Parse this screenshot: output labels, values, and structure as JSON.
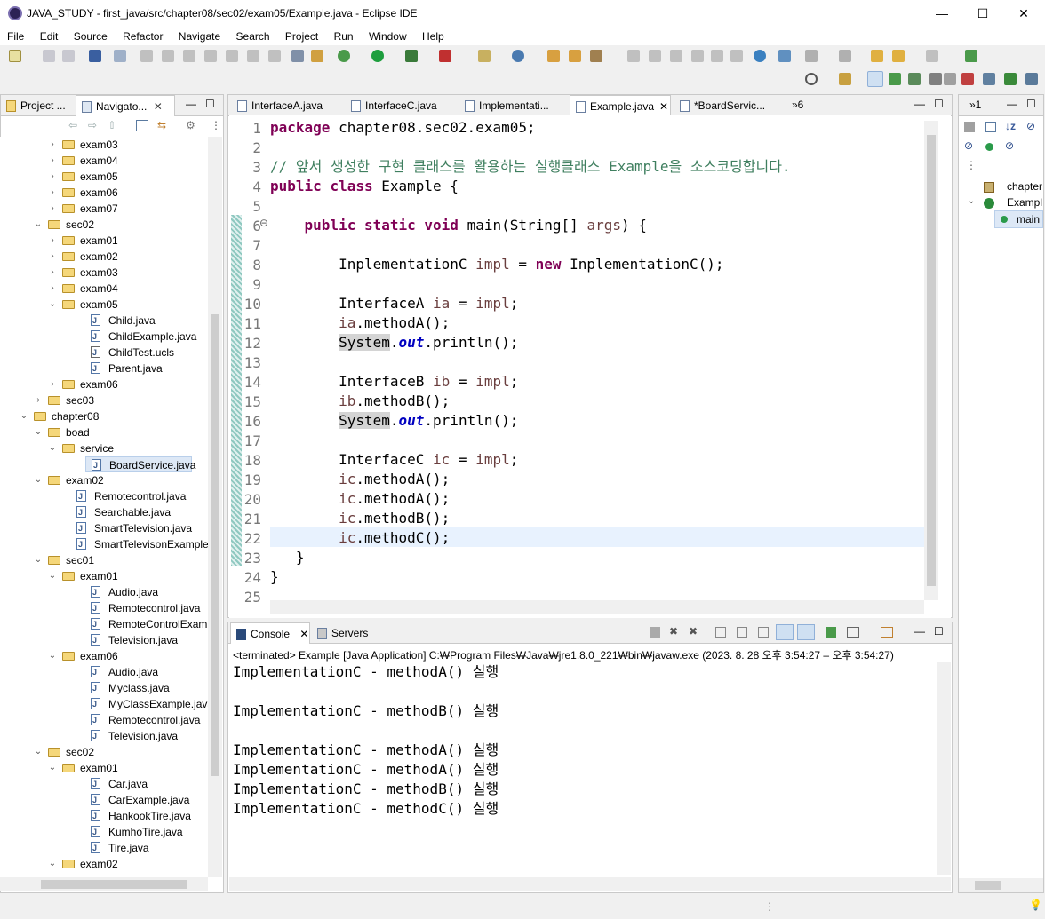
{
  "window": {
    "title": "JAVA_STUDY - first_java/src/chapter08/sec02/exam05/Example.java - Eclipse IDE",
    "minimize": "—",
    "maximize": "☐",
    "close": "✕"
  },
  "menu": [
    "File",
    "Edit",
    "Source",
    "Refactor",
    "Navigate",
    "Search",
    "Project",
    "Run",
    "Window",
    "Help"
  ],
  "left_tabs": {
    "project": "Project ...",
    "navigator": "Navigato..."
  },
  "editor_tabs": [
    "InterfaceA.java",
    "InterfaceC.java",
    "Implementati...",
    "Example.java",
    "*BoardServic..."
  ],
  "editor_overflow": "»6",
  "tree": [
    {
      "label": "exam03",
      "indent": 1,
      "type": "folder",
      "arrow": "›"
    },
    {
      "label": "exam04",
      "indent": 1,
      "type": "folder",
      "arrow": "›"
    },
    {
      "label": "exam05",
      "indent": 1,
      "type": "folder",
      "arrow": "›"
    },
    {
      "label": "exam06",
      "indent": 1,
      "type": "folder",
      "arrow": "›"
    },
    {
      "label": "exam07",
      "indent": 1,
      "type": "folder",
      "arrow": "›"
    },
    {
      "label": "sec02",
      "indent": 0,
      "type": "folder",
      "arrow": "⌄"
    },
    {
      "label": "exam01",
      "indent": 1,
      "type": "folder",
      "arrow": "›"
    },
    {
      "label": "exam02",
      "indent": 1,
      "type": "folder",
      "arrow": "›"
    },
    {
      "label": "exam03",
      "indent": 1,
      "type": "folder",
      "arrow": "›"
    },
    {
      "label": "exam04",
      "indent": 1,
      "type": "folder",
      "arrow": "›"
    },
    {
      "label": "exam05",
      "indent": 1,
      "type": "folder",
      "arrow": "⌄"
    },
    {
      "label": "Child.java",
      "indent": 2,
      "type": "file"
    },
    {
      "label": "ChildExample.java",
      "indent": 2,
      "type": "file"
    },
    {
      "label": "ChildTest.ucls",
      "indent": 2,
      "type": "ucls"
    },
    {
      "label": "Parent.java",
      "indent": 2,
      "type": "file"
    },
    {
      "label": "exam06",
      "indent": 1,
      "type": "folder",
      "arrow": "›"
    },
    {
      "label": "sec03",
      "indent": 0,
      "type": "folder",
      "arrow": "›"
    },
    {
      "label": "chapter08",
      "indent": -1,
      "type": "folder",
      "arrow": "⌄"
    },
    {
      "label": "boad",
      "indent": 0,
      "type": "folder",
      "arrow": "⌄"
    },
    {
      "label": "service",
      "indent": 1,
      "type": "folder",
      "arrow": "⌄"
    },
    {
      "label": "BoardService.java",
      "indent": 2,
      "type": "file",
      "selected": true
    },
    {
      "label": "exam02",
      "indent": 0,
      "type": "folder",
      "arrow": "⌄"
    },
    {
      "label": "Remotecontrol.java",
      "indent": 1,
      "type": "file"
    },
    {
      "label": "Searchable.java",
      "indent": 1,
      "type": "file"
    },
    {
      "label": "SmartTelevision.java",
      "indent": 1,
      "type": "file"
    },
    {
      "label": "SmartTelevisonExample.java",
      "indent": 1,
      "type": "file"
    },
    {
      "label": "sec01",
      "indent": 0,
      "type": "folder",
      "arrow": "⌄"
    },
    {
      "label": "exam01",
      "indent": 1,
      "type": "folder",
      "arrow": "⌄"
    },
    {
      "label": "Audio.java",
      "indent": 2,
      "type": "file"
    },
    {
      "label": "Remotecontrol.java",
      "indent": 2,
      "type": "file"
    },
    {
      "label": "RemoteControlExample.jav",
      "indent": 2,
      "type": "file"
    },
    {
      "label": "Television.java",
      "indent": 2,
      "type": "file"
    },
    {
      "label": "exam06",
      "indent": 1,
      "type": "folder",
      "arrow": "⌄"
    },
    {
      "label": "Audio.java",
      "indent": 2,
      "type": "file"
    },
    {
      "label": "Myclass.java",
      "indent": 2,
      "type": "file"
    },
    {
      "label": "MyClassExample.java",
      "indent": 2,
      "type": "file"
    },
    {
      "label": "Remotecontrol.java",
      "indent": 2,
      "type": "file"
    },
    {
      "label": "Television.java",
      "indent": 2,
      "type": "file"
    },
    {
      "label": "sec02",
      "indent": 0,
      "type": "folder",
      "arrow": "⌄"
    },
    {
      "label": "exam01",
      "indent": 1,
      "type": "folder",
      "arrow": "⌄"
    },
    {
      "label": "Car.java",
      "indent": 2,
      "type": "file"
    },
    {
      "label": "CarExample.java",
      "indent": 2,
      "type": "file"
    },
    {
      "label": "HankookTire.java",
      "indent": 2,
      "type": "file"
    },
    {
      "label": "KumhoTire.java",
      "indent": 2,
      "type": "file"
    },
    {
      "label": "Tire.java",
      "indent": 2,
      "type": "file"
    },
    {
      "label": "exam02",
      "indent": 1,
      "type": "folder",
      "arrow": "⌄"
    }
  ],
  "code": [
    [
      [
        "kw",
        "package"
      ],
      [
        "",
        "chapter08.sec02.exam05;"
      ]
    ],
    [],
    [
      [
        "cm",
        "// 앞서 생성한 구현 클래스를 활용하는 실행클래스 Example을 소스코딩합니다."
      ]
    ],
    [
      [
        "kw",
        "public"
      ],
      [
        "kw",
        "class"
      ],
      [
        "",
        "Example {"
      ]
    ],
    [],
    [
      [
        "",
        "    "
      ],
      [
        "kw",
        "public"
      ],
      [
        "kw",
        "static"
      ],
      [
        "kw",
        "void"
      ],
      [
        "",
        "main(String[] "
      ],
      [
        "vr",
        "args"
      ],
      [
        "",
        ") {"
      ]
    ],
    [],
    [
      [
        "",
        "        InplementationC "
      ],
      [
        "vr",
        "impl"
      ],
      [
        "",
        " = "
      ],
      [
        "kw",
        "new"
      ],
      [
        "",
        "InplementationC();"
      ]
    ],
    [],
    [
      [
        "",
        "        InterfaceA "
      ],
      [
        "vr",
        "ia"
      ],
      [
        "",
        " = "
      ],
      [
        "vr",
        "impl"
      ],
      [
        "",
        ";"
      ]
    ],
    [
      [
        "",
        "        "
      ],
      [
        "vr",
        "ia"
      ],
      [
        "",
        ".methodA();"
      ]
    ],
    [
      [
        "",
        "        "
      ],
      [
        "sy",
        "System"
      ],
      [
        "",
        "."
      ],
      [
        "st",
        "out"
      ],
      [
        "",
        ".println();"
      ]
    ],
    [],
    [
      [
        "",
        "        InterfaceB "
      ],
      [
        "vr",
        "ib"
      ],
      [
        "",
        " = "
      ],
      [
        "vr",
        "impl"
      ],
      [
        "",
        ";"
      ]
    ],
    [
      [
        "",
        "        "
      ],
      [
        "vr",
        "ib"
      ],
      [
        "",
        ".methodB();"
      ]
    ],
    [
      [
        "",
        "        "
      ],
      [
        "sy",
        "System"
      ],
      [
        "",
        "."
      ],
      [
        "st",
        "out"
      ],
      [
        "",
        ".println();"
      ]
    ],
    [],
    [
      [
        "",
        "        InterfaceC "
      ],
      [
        "vr",
        "ic"
      ],
      [
        "",
        " = "
      ],
      [
        "vr",
        "impl"
      ],
      [
        "",
        ";"
      ]
    ],
    [
      [
        "",
        "        "
      ],
      [
        "vr",
        "ic"
      ],
      [
        "",
        ".methodA();"
      ]
    ],
    [
      [
        "",
        "        "
      ],
      [
        "vr",
        "ic"
      ],
      [
        "",
        ".methodA();"
      ]
    ],
    [
      [
        "",
        "        "
      ],
      [
        "vr",
        "ic"
      ],
      [
        "",
        ".methodB();"
      ]
    ],
    [
      [
        "",
        "        "
      ],
      [
        "vr",
        "ic"
      ],
      [
        "",
        ".methodC();"
      ]
    ],
    [
      [
        "",
        "   }"
      ]
    ],
    [
      [
        "",
        "}"
      ]
    ],
    []
  ],
  "line_numbers": [
    "1",
    "2",
    "3",
    "4",
    "5",
    "6",
    "7",
    "8",
    "9",
    "10",
    "11",
    "12",
    "13",
    "14",
    "15",
    "16",
    "17",
    "18",
    "19",
    "20",
    "21",
    "22",
    "23",
    "24",
    "25"
  ],
  "fold_marker": "⊖",
  "console": {
    "tab": "Console",
    "servers_tab": "Servers",
    "header": "<terminated> Example [Java Application] C:₩Program Files₩Java₩jre1.8.0_221₩bin₩javaw.exe  (2023. 8. 28 오후 3:54:27 – 오후 3:54:27)",
    "lines": [
      "ImplementationC - methodA() 실행",
      "",
      "ImplementationC - methodB() 실행",
      "",
      "ImplementationC - methodA() 실행",
      "ImplementationC - methodA() 실행",
      "ImplementationC - methodB() 실행",
      "ImplementationC - methodC() 실행"
    ]
  },
  "outline": {
    "tab": "»1",
    "items": [
      "chapter",
      "Exampl",
      "main"
    ]
  },
  "colors": {
    "keyword": "#7f0055",
    "comment": "#3f7f5f",
    "variable": "#6a3e3e",
    "static_field": "#0000c0",
    "current_line": "#e8f2fe"
  }
}
